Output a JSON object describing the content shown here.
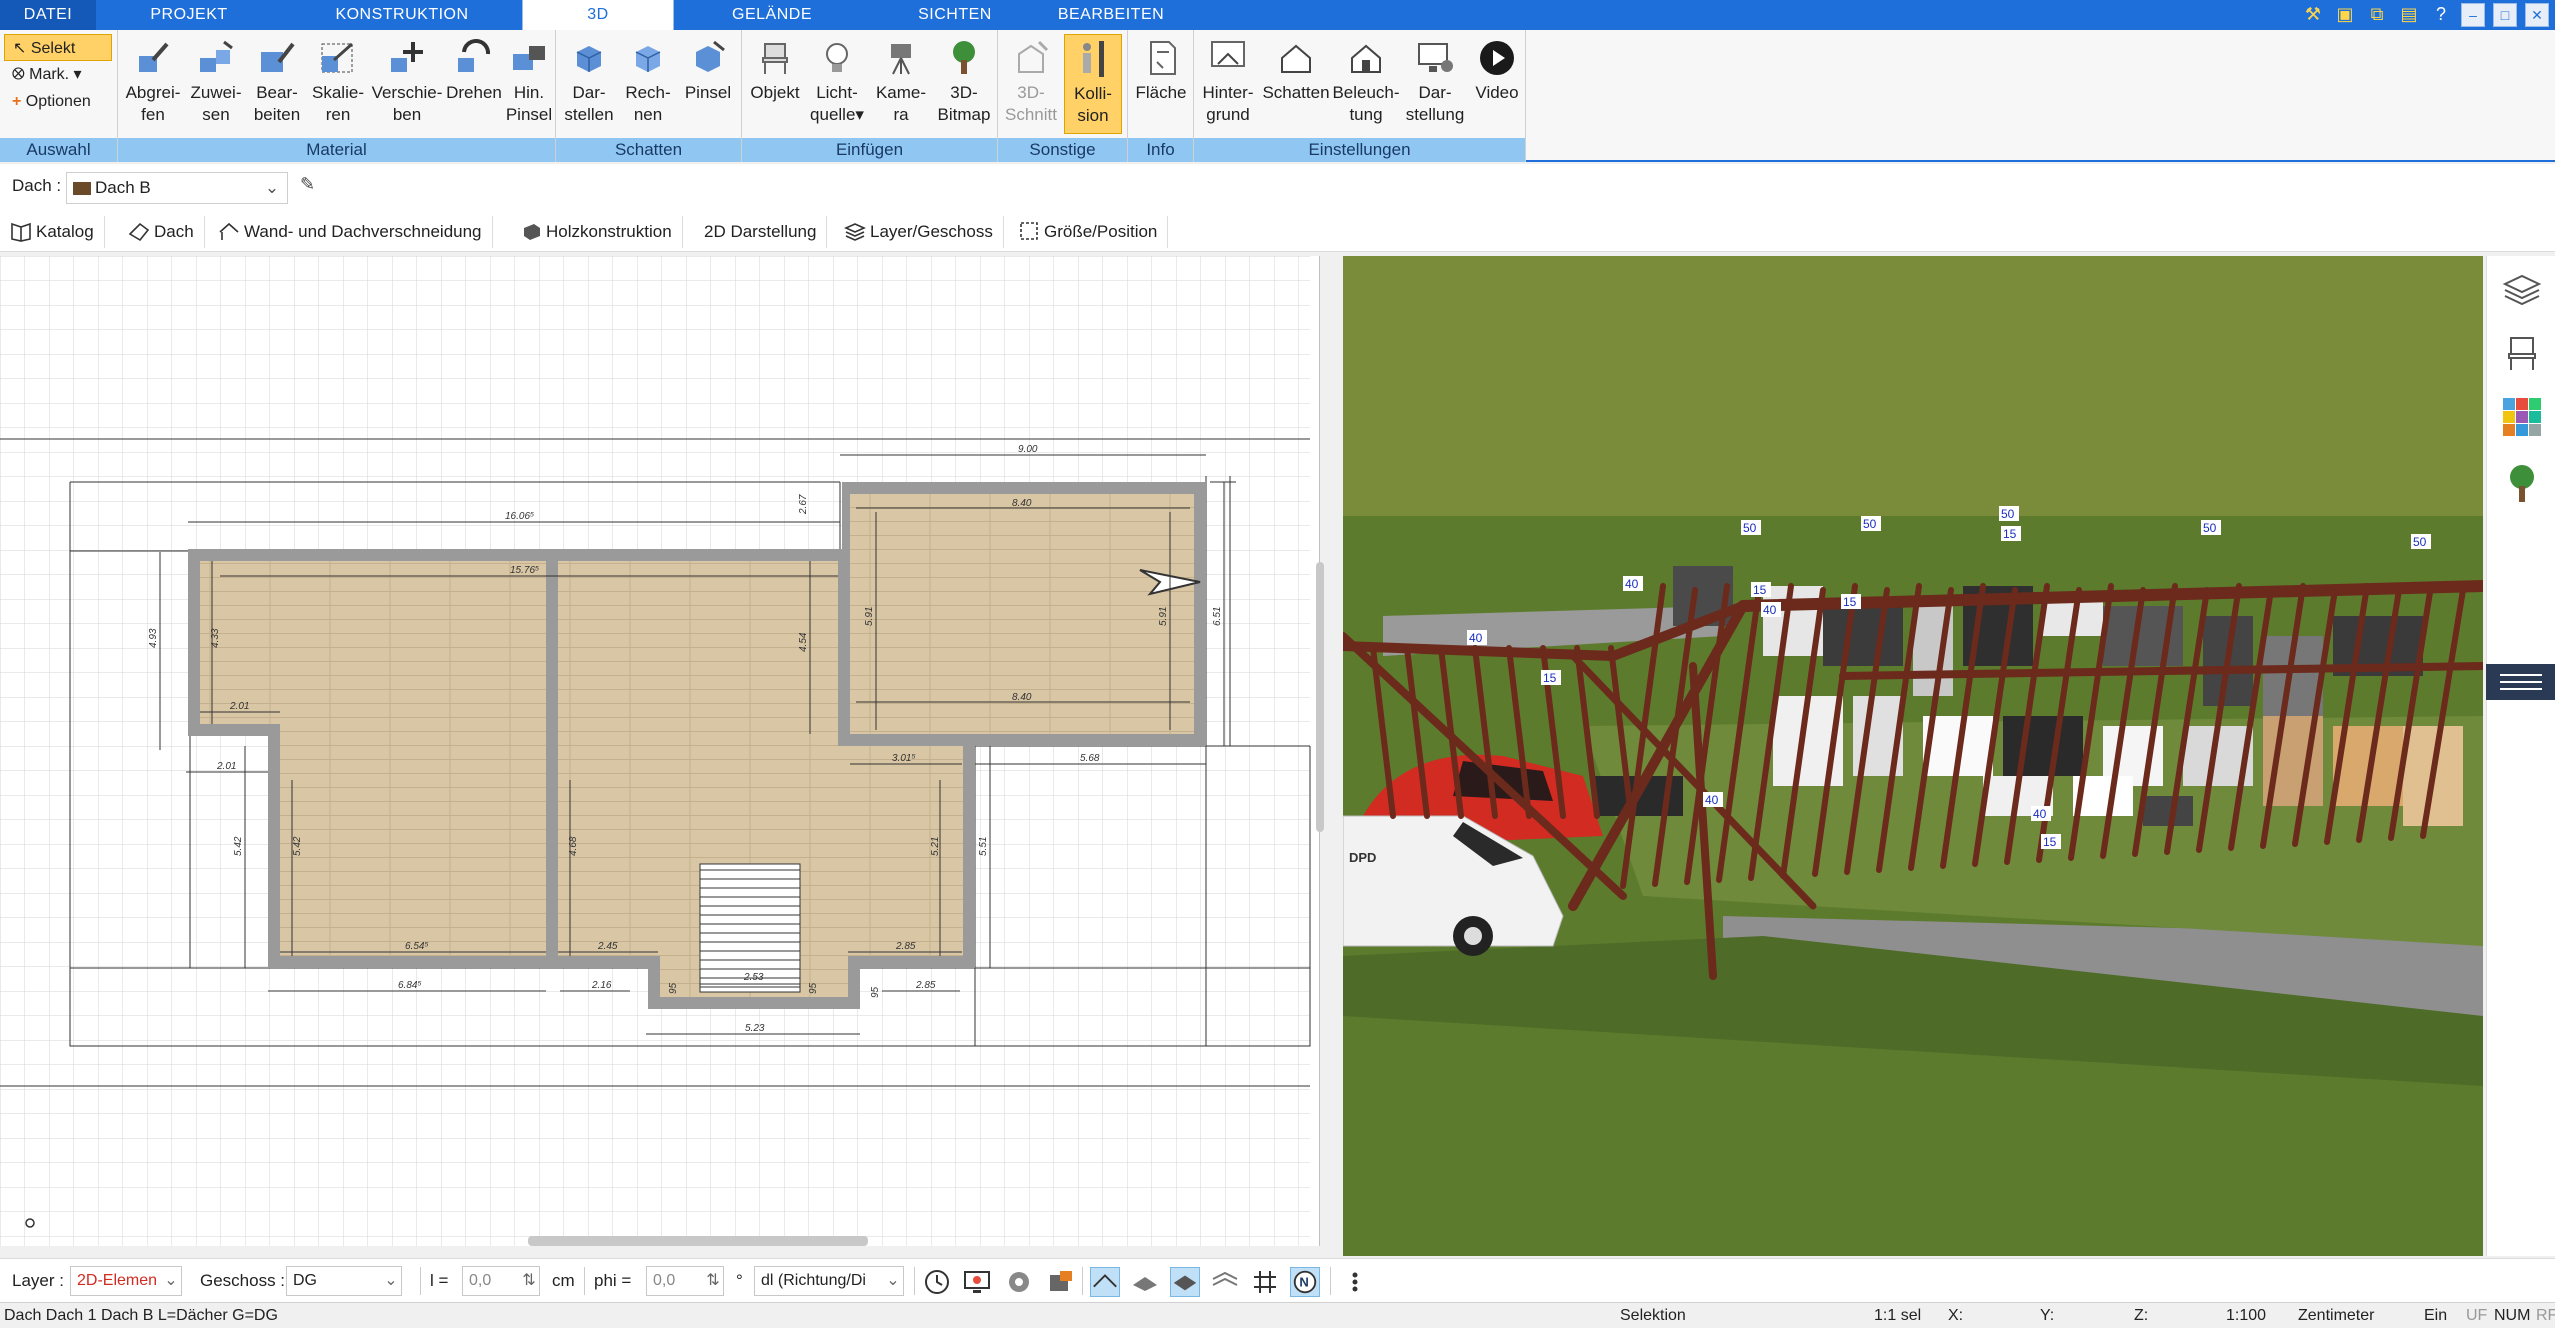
{
  "menu": {
    "tabs": [
      {
        "label": "DATEI"
      },
      {
        "label": "PROJEKT"
      },
      {
        "label": "KONSTRUKTION"
      },
      {
        "label": "3D"
      },
      {
        "label": "GELÄNDE"
      },
      {
        "label": "SICHTEN"
      },
      {
        "label": "BEARBEITEN"
      }
    ],
    "active_tab": "3D"
  },
  "ribbon": {
    "auswahl": {
      "label": "Auswahl",
      "selekt": "Selekt",
      "mark": "Mark.",
      "optionen": "Optionen"
    },
    "material": {
      "label": "Material",
      "buttons": [
        {
          "l1": "Abgrei-",
          "l2": "fen"
        },
        {
          "l1": "Zuwei-",
          "l2": "sen"
        },
        {
          "l1": "Bear-",
          "l2": "beiten"
        },
        {
          "l1": "Skalie-",
          "l2": "ren"
        },
        {
          "l1": "Verschie-",
          "l2": "ben"
        },
        {
          "l1": "Drehen",
          "l2": ""
        },
        {
          "l1": "Hin.",
          "l2": "Pinsel"
        }
      ]
    },
    "schatten": {
      "label": "Schatten",
      "buttons": [
        {
          "l1": "Dar-",
          "l2": "stellen"
        },
        {
          "l1": "Rech-",
          "l2": "nen"
        },
        {
          "l1": "Pinsel",
          "l2": ""
        }
      ]
    },
    "einfuegen": {
      "label": "Einfügen",
      "buttons": [
        {
          "l1": "Objekt",
          "l2": ""
        },
        {
          "l1": "Licht-",
          "l2": "quelle"
        },
        {
          "l1": "Kame-",
          "l2": "ra"
        },
        {
          "l1": "3D-",
          "l2": "Bitmap"
        }
      ]
    },
    "sonstige": {
      "label": "Sonstige",
      "buttons": [
        {
          "l1": "3D-",
          "l2": "Schnitt"
        },
        {
          "l1": "Kolli-",
          "l2": "sion"
        }
      ]
    },
    "info": {
      "label": "Info",
      "buttons": [
        {
          "l1": "Fläche",
          "l2": ""
        }
      ]
    },
    "einstellungen": {
      "label": "Einstellungen",
      "buttons": [
        {
          "l1": "Hinter-",
          "l2": "grund"
        },
        {
          "l1": "Schatten",
          "l2": ""
        },
        {
          "l1": "Beleuch-",
          "l2": "tung"
        },
        {
          "l1": "Dar-",
          "l2": "stellung"
        },
        {
          "l1": "Video",
          "l2": ""
        }
      ]
    }
  },
  "dach_row": {
    "label": "Dach :",
    "selected": "Dach B"
  },
  "toolbar2": [
    {
      "label": "Katalog"
    },
    {
      "label": "Dach"
    },
    {
      "label": "Wand- und Dachverschneidung"
    },
    {
      "label": "Holzkonstruktion"
    },
    {
      "label": "2D Darstellung"
    },
    {
      "label": "Layer/Geschoss"
    },
    {
      "label": "Größe/Position"
    }
  ],
  "plan": {
    "dimensions": [
      "9.00",
      "16.06⁵",
      "2.67",
      "8.40",
      "15.76⁵",
      "4.93",
      "4.33",
      "4.54",
      "5.91",
      "5.91",
      "6.51",
      "8.40",
      "2.01",
      "2.01",
      "3.01⁵",
      "5.68",
      "5.42",
      "5.42",
      "4.68",
      "5.21",
      "5.51",
      "6.54⁵",
      "2.45",
      "2.85",
      "2.53",
      "95",
      "95",
      "95",
      "2.16",
      "2.85",
      "6.84⁵",
      "5.23"
    ]
  },
  "view3d": {
    "labels": [
      "50",
      "50",
      "50",
      "50",
      "50",
      "40",
      "40",
      "40",
      "40",
      "40",
      "15",
      "15",
      "15",
      "15",
      "15"
    ],
    "van_text": "DPD",
    "colors": {
      "grass": "#5d7b2c",
      "beam": "#6b2a1c",
      "path": "#8f8f8f"
    }
  },
  "parambar": {
    "layer_label": "Layer :",
    "layer_value": "2D-Elemen",
    "geschoss_label": "Geschoss :",
    "geschoss_value": "DG",
    "l_label": "l =",
    "l_value": "0,0",
    "l_unit": "cm",
    "phi_label": "phi =",
    "phi_value": "0,0",
    "phi_unit": "°",
    "dir_value": "dl (Richtung/Di"
  },
  "status": {
    "left": "Dach Dach 1 Dach B L=Dächer G=DG",
    "mode": "Selektion",
    "sel": "1:1 sel",
    "x": "X:",
    "y": "Y:",
    "z": "Z:",
    "scale": "1:100",
    "unit": "Zentimeter",
    "ein": "Ein",
    "uf": "UF",
    "num": "NUM",
    "rf": "RF"
  }
}
